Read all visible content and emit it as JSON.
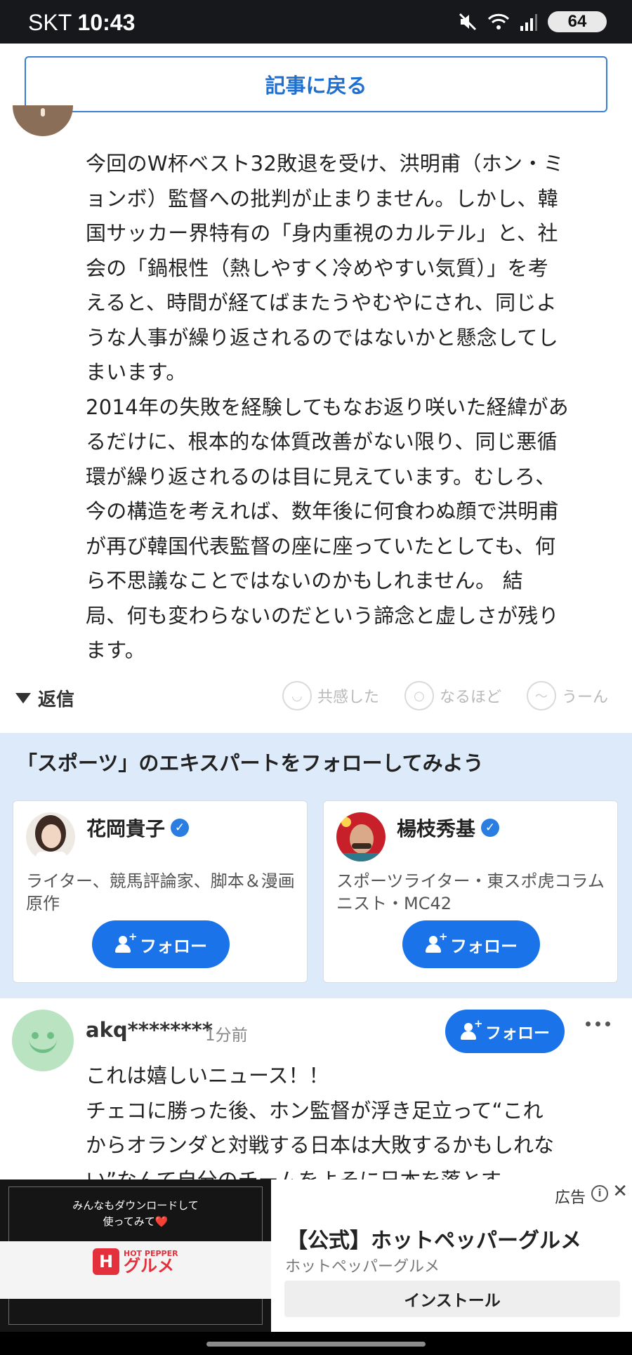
{
  "status_bar": {
    "carrier": "SKT",
    "time": "10:43",
    "battery": "64"
  },
  "back_button": {
    "label": "記事に戻る"
  },
  "comment1": {
    "text": "今回のW杯ベスト32敗退を受け、洪明甫（ホン・ミ\nョンボ）監督への批判が止まりません。しかし、韓\n国サッカー界特有の「身内重視のカルテル」と、社\n会の「鍋根性（熱しやすく冷めやすい気質）」を考\nえると、時間が経てばまたうやむやにされ、同じよ\nうな人事が繰り返されるのではないかと懸念してし\nまいます。\n2014年の失敗を経験してもなお返り咲いた経緯があ\nるだけに、根本的な体質改善がない限り、同じ悪循\n環が繰り返されるのは目に見えています。むしろ、\n今の構造を考えれば、数年後に何食わぬ顔で洪明甫\nが再び韓国代表監督の座に座っていたとしても、何\nら不思議なことではないのかもしれません。 結\n局、何も変わらないのだという諦念と虚しさが残り\nます。",
    "reply_label": "返信",
    "reactions": [
      "共感した",
      "なるほど",
      "うーん"
    ]
  },
  "experts": {
    "heading": "「スポーツ」のエキスパートをフォローしてみよう",
    "cards": [
      {
        "name": "花岡貴子",
        "desc": "ライター、競馬評論家、脚本＆漫画原作",
        "follow": "フォロー"
      },
      {
        "name": "楊枝秀基",
        "desc": "スポーツライター・東スポ虎コラムニスト・MC42",
        "follow": "フォロー"
      }
    ]
  },
  "comment2": {
    "user": "akq********",
    "time": "1分前",
    "follow": "フォロー",
    "text": "これは嬉しいニュース！！\nチェコに勝った後、ホン監督が浮き足立って“これ\nからオランダと対戦する日本は大敗するかもしれな\nい”なんて自分のチームをよそに日本を落とす"
  },
  "ad": {
    "label": "広告",
    "image_caption": "みんなもダウンロードして\n使ってみて❤️",
    "logo_en": "HOT PEPPER",
    "logo_jp": "グルメ",
    "title": "【公式】ホットペッパーグルメ",
    "subtitle": "ホットペッパーグルメ",
    "install": "インストール"
  },
  "colors": {
    "accent": "#1a73e8",
    "experts_bg": "#dceaf9",
    "status_bg": "#17181c"
  }
}
